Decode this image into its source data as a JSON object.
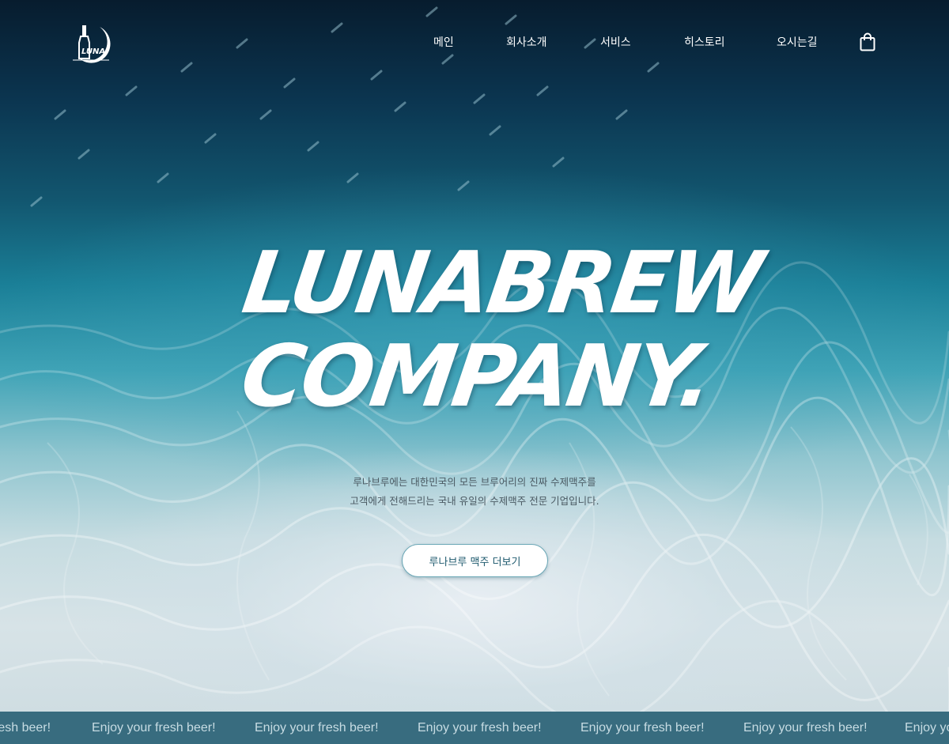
{
  "brand": {
    "logo_text": "LUNA",
    "logo_icon": "moon-bottle-logo"
  },
  "nav": {
    "items": [
      {
        "label": "메인"
      },
      {
        "label": "회사소개"
      },
      {
        "label": "서비스"
      },
      {
        "label": "히스토리"
      },
      {
        "label": "오시는길"
      }
    ],
    "cart_icon": "shopping-bag-icon"
  },
  "hero": {
    "headline_line1": "LUNABREW",
    "headline_line2": "COMPANY.",
    "description_line1": "루나브루에는 대한민국의 모든 브루어리의 진짜 수제맥주를",
    "description_line2": "고객에게 전해드리는 국내 유일의 수제맥주 전문 기업입니다.",
    "cta_label": "루나브루 맥주 더보기"
  },
  "ticker": {
    "items": [
      "resh beer!",
      "Enjoy your fresh beer!",
      "Enjoy your fresh beer!",
      "Enjoy your fresh beer!",
      "Enjoy your fresh beer!",
      "Enjoy your fresh beer!",
      "Enjoy your"
    ]
  },
  "colors": {
    "ticker_bg": "#386c7f",
    "ticker_text": "#c7dce3",
    "cta_text": "#1e5a6e",
    "deep_water": "#071c2e"
  }
}
